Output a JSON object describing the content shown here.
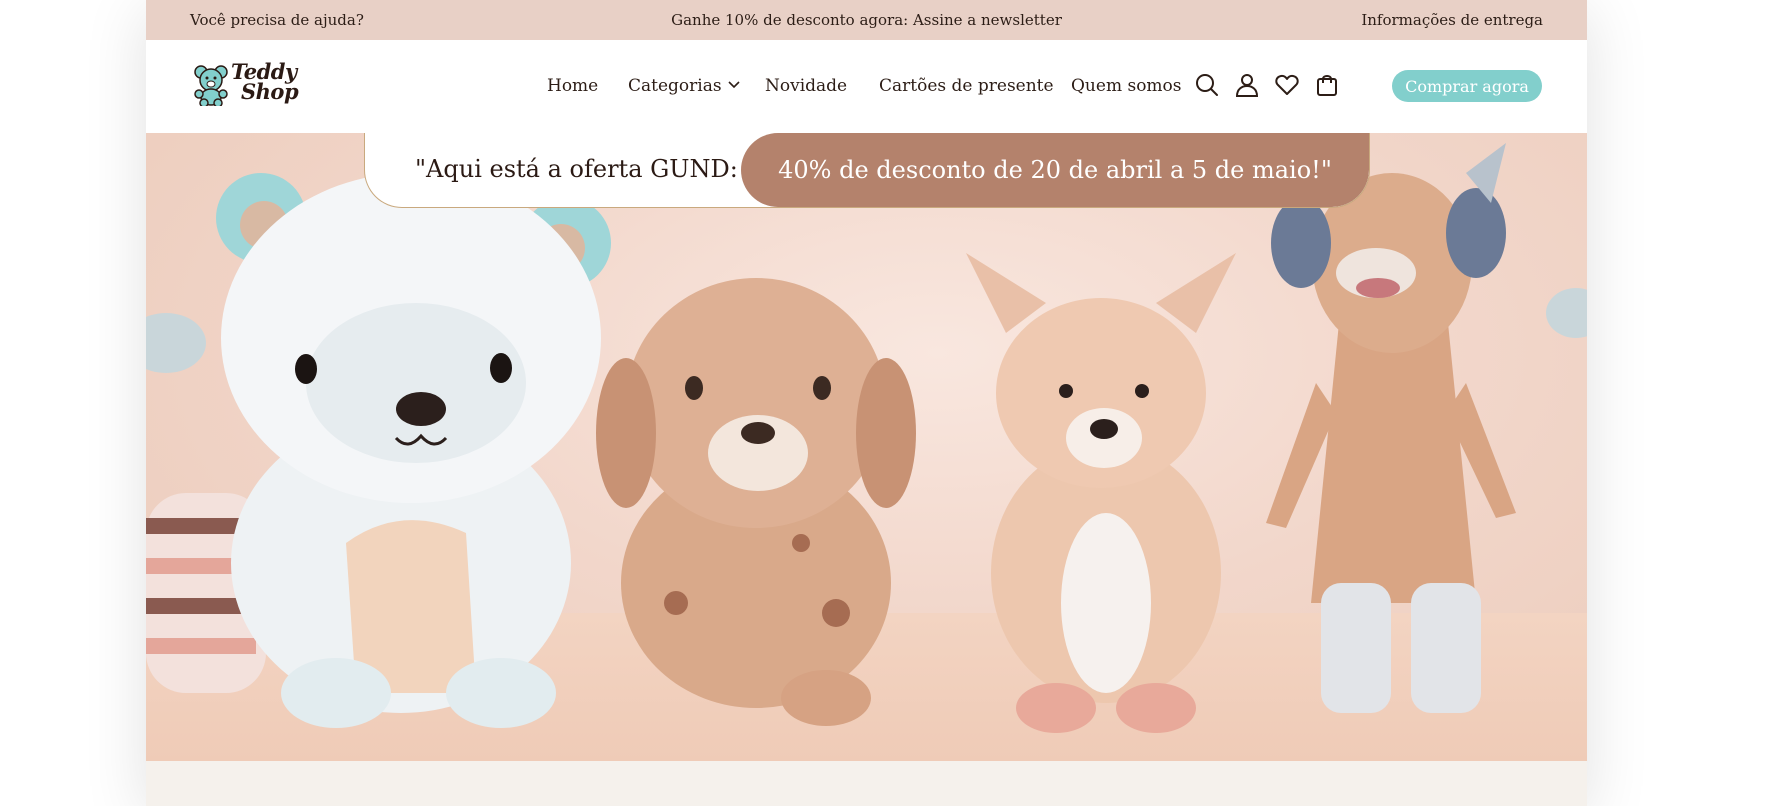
{
  "topbar": {
    "help": "Você precisa de ajuda?",
    "promo": "Ganhe 10% de desconto agora: Assine a newsletter",
    "delivery": "Informações de entrega"
  },
  "logo": {
    "line1": "Teddy",
    "line2": "Shop"
  },
  "nav": {
    "home": "Home",
    "categories": "Categorias",
    "new": "Novidade",
    "gift_cards": "Cartões de presente",
    "about": "Quem somos"
  },
  "icons": {
    "search": "search-icon",
    "account": "user-icon",
    "wishlist": "heart-icon",
    "cart": "shopping-bag-icon"
  },
  "cta": {
    "label": "Comprar agora"
  },
  "hero": {
    "offer_intro": "\"Aqui está a oferta GUND:",
    "offer_detail": "40% de desconto de 20 de abril a 5 de maio!\"",
    "image": "plush-toys-hero-image"
  },
  "colors": {
    "topbar_bg": "#e8d0c6",
    "accent": "#82cfcc",
    "banner_accent": "#b4826c",
    "text": "#2c1d16"
  }
}
